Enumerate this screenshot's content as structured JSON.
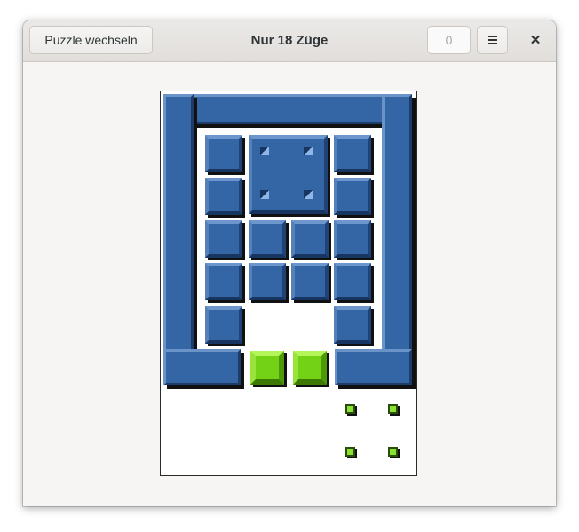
{
  "header": {
    "switch_label": "Puzzle wechseln",
    "title": "Nur 18 Züge",
    "move_counter": "0",
    "menu_icon": "hamburger-menu-icon",
    "close_icon": "close-icon",
    "close_glyph": "✕"
  },
  "puzzle": {
    "block_color": "#3465a4",
    "goal_color": "#73d216",
    "blue_blocks": 16,
    "large_blocks": 1,
    "green_blocks": 2,
    "target_markers": 4
  }
}
